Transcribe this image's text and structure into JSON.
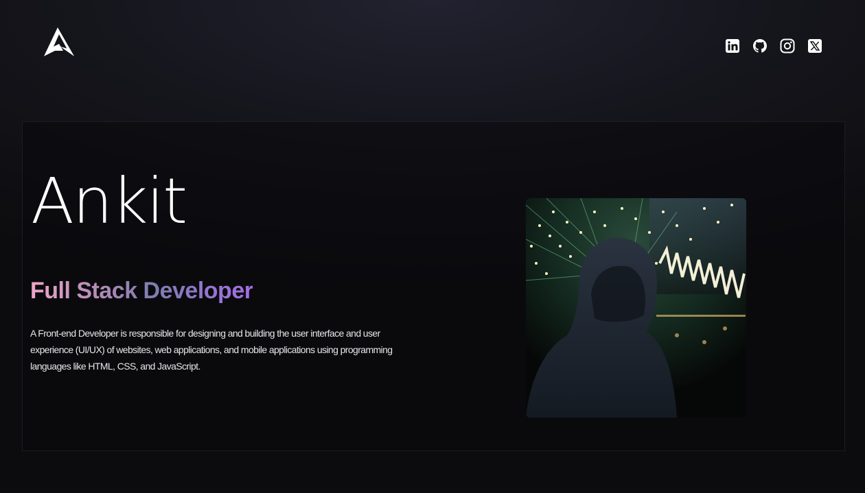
{
  "header": {
    "logo_icon": "stylized-a-logo-icon",
    "social": [
      {
        "name": "LinkedIn",
        "icon": "linkedin-icon"
      },
      {
        "name": "GitHub",
        "icon": "github-icon"
      },
      {
        "name": "Instagram",
        "icon": "instagram-icon"
      },
      {
        "name": "X",
        "icon": "x-twitter-icon"
      }
    ]
  },
  "hero": {
    "name": "Ankit",
    "role": "Full Stack Developer",
    "description": "A Front-end Developer is responsible for designing and building the user interface and user experience (UI/UX) of websites, web applications, and mobile applications using programming languages like HTML, CSS, and JavaScript.",
    "photo_icon": "profile-photo-hooded-figure"
  },
  "colors": {
    "gradient_start": "#f0a6c9",
    "gradient_mid": "#7e7db0",
    "gradient_end": "#a56ee6",
    "background": "#0c0c0e"
  }
}
